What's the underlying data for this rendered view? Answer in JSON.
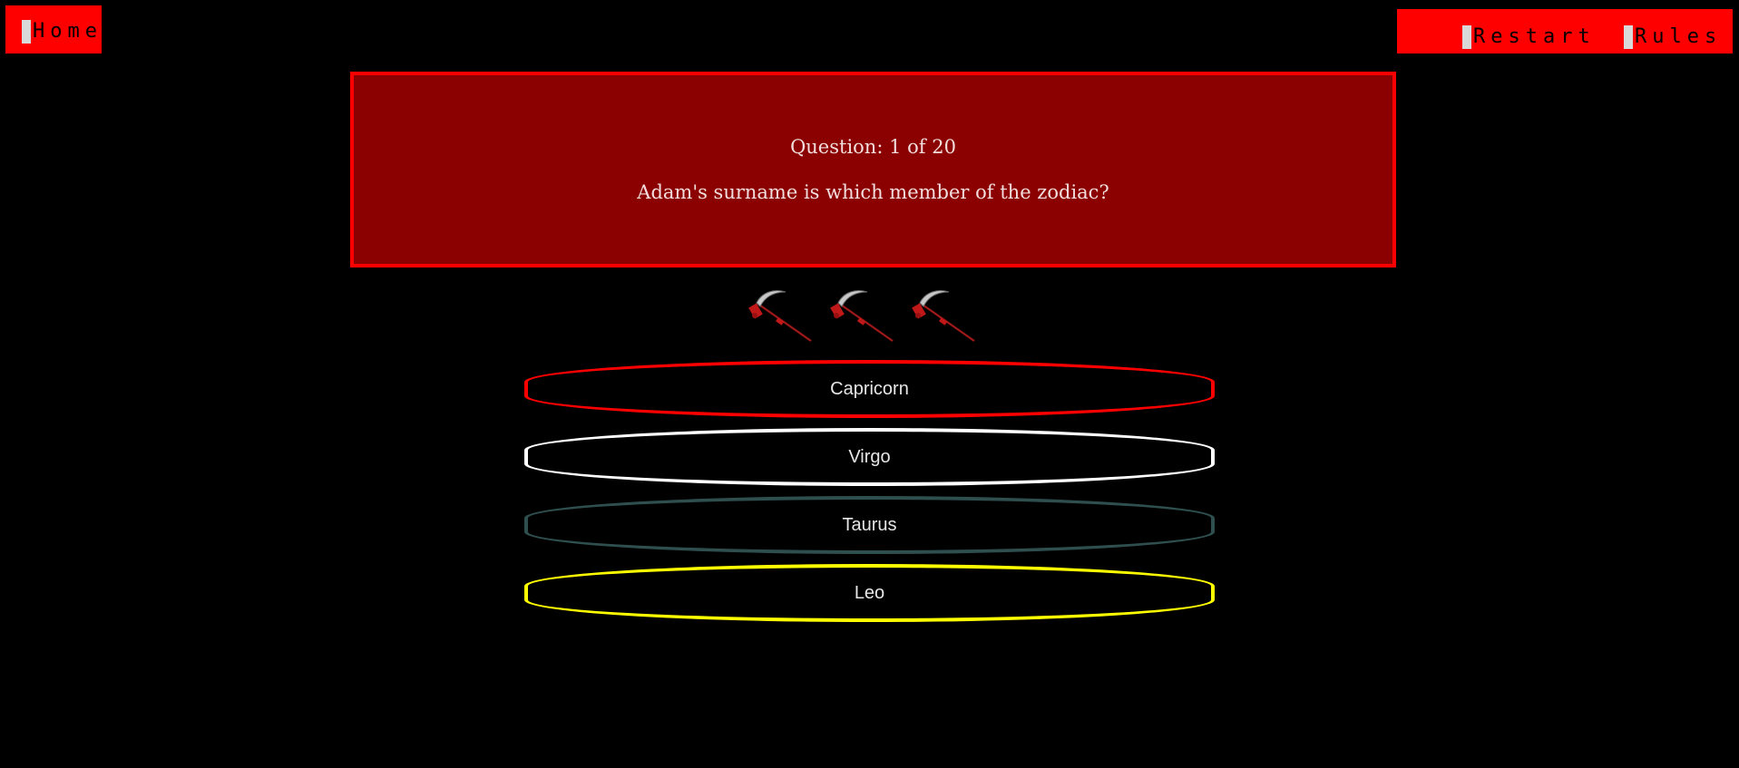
{
  "nav": {
    "home_label": "Home",
    "restart_label": "Restart",
    "rules_label": "Rules"
  },
  "question": {
    "counter": "Question: 1 of 20",
    "text": "Adam's surname is which member of the zodiac?"
  },
  "lives": {
    "count": 3,
    "icon": "scythe-icon"
  },
  "answers": [
    {
      "label": "Capricorn",
      "border_color": "#ff0000"
    },
    {
      "label": "Virgo",
      "border_color": "#ffffff"
    },
    {
      "label": "Taurus",
      "border_color": "#2f4f4f"
    },
    {
      "label": "Leo",
      "border_color": "#ffff00"
    }
  ],
  "colors": {
    "background": "#000000",
    "nav_accent": "#ff0000",
    "question_box": "#8b0000",
    "question_border": "#ff0000"
  }
}
